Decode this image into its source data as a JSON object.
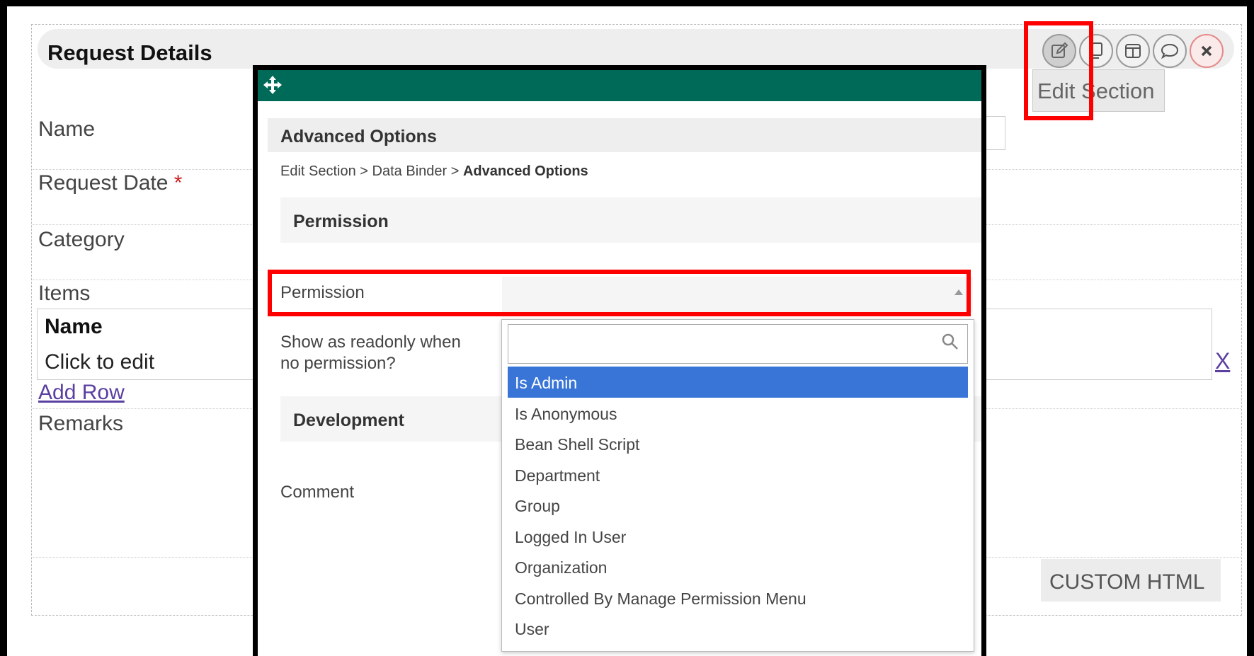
{
  "section": {
    "title": "Request Details",
    "tooltip": "Edit Section",
    "toolbar": [
      {
        "name": "edit-section",
        "icon": "pencil-icon"
      },
      {
        "name": "copy-section",
        "icon": "copy-icon"
      },
      {
        "name": "columns-section",
        "icon": "columns-icon"
      },
      {
        "name": "comment-section",
        "icon": "speech-bubble-icon"
      },
      {
        "name": "delete-section",
        "icon": "close-icon"
      }
    ]
  },
  "form": {
    "fields": {
      "name": "Name",
      "request_date": "Request Date",
      "required_mark": "*",
      "category": "Category",
      "items": "Items",
      "remarks": "Remarks"
    },
    "grid": {
      "header": "Name",
      "row_placeholder": "Click to edit",
      "remove_label": "X",
      "add_row": "Add Row"
    },
    "custom_html": "CUSTOM HTML"
  },
  "dialog": {
    "title": "Advanced Options",
    "breadcrumb": {
      "item1": "Edit Section",
      "sep": ">",
      "item2": "Data Binder",
      "current": "Advanced Options"
    },
    "permission_section": "Permission",
    "permission_label": "Permission",
    "readonly_label_line1": "Show as readonly when",
    "readonly_label_line2": "no permission?",
    "development_section": "Development",
    "comment_label": "Comment",
    "dropdown": {
      "search_value": "",
      "options": [
        "Is Admin",
        "Is Anonymous",
        "Bean Shell Script",
        "Department",
        "Group",
        "Logged In User",
        "Organization",
        "Controlled By Manage Permission Menu",
        "User"
      ],
      "selected_index": 0
    }
  },
  "colors": {
    "modal_bar": "#006a58",
    "highlight": "#ff0000",
    "selected_option": "#3875d7",
    "link": "#5b3fa1"
  }
}
